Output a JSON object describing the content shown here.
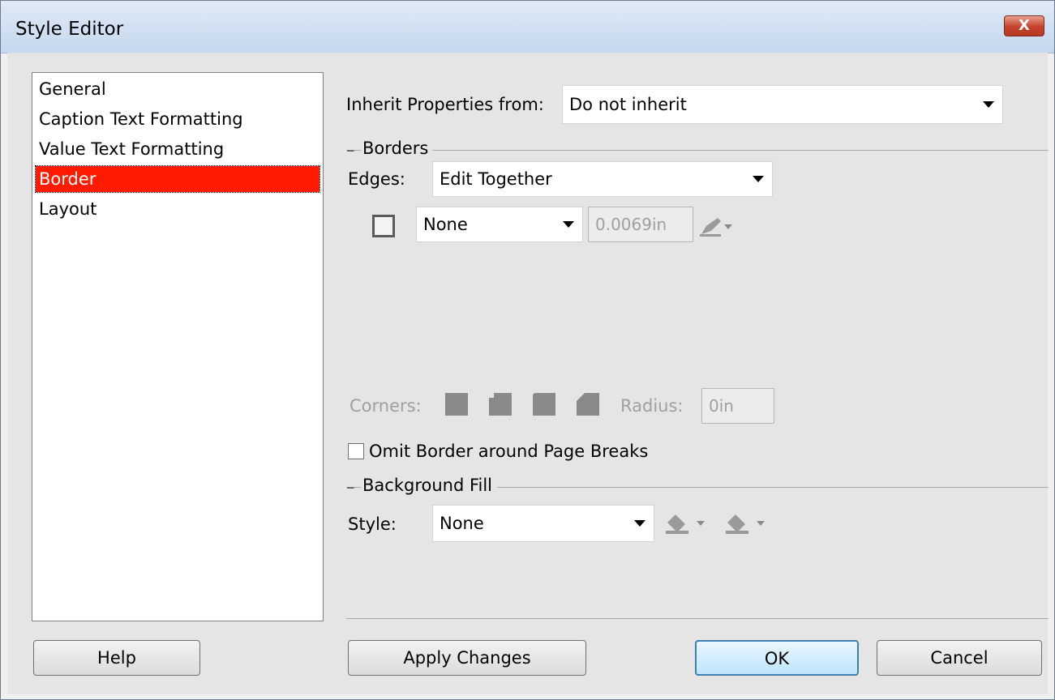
{
  "window": {
    "title": "Style Editor",
    "close_label": "X"
  },
  "categories": [
    {
      "label": "General",
      "selected": false
    },
    {
      "label": "Caption Text Formatting",
      "selected": false
    },
    {
      "label": "Value Text Formatting",
      "selected": false
    },
    {
      "label": "Border",
      "selected": true
    },
    {
      "label": "Layout",
      "selected": false
    }
  ],
  "inherit": {
    "label": "Inherit Properties from:",
    "value": "Do not inherit"
  },
  "borders": {
    "group_title": "Borders",
    "edges_label": "Edges:",
    "edges_value": "Edit Together",
    "line_style_value": "None",
    "width_value": "0.0069in",
    "corners_label": "Corners:",
    "radius_label": "Radius:",
    "radius_value": "0in",
    "omit_label": "Omit Border around Page Breaks",
    "omit_checked": false
  },
  "background": {
    "group_title": "Background Fill",
    "style_label": "Style:",
    "style_value": "None"
  },
  "buttons": {
    "help": "Help",
    "apply": "Apply Changes",
    "ok": "OK",
    "cancel": "Cancel"
  },
  "colors": {
    "selection": "#ff1a00",
    "default_button_border": "#3c7fb1"
  }
}
